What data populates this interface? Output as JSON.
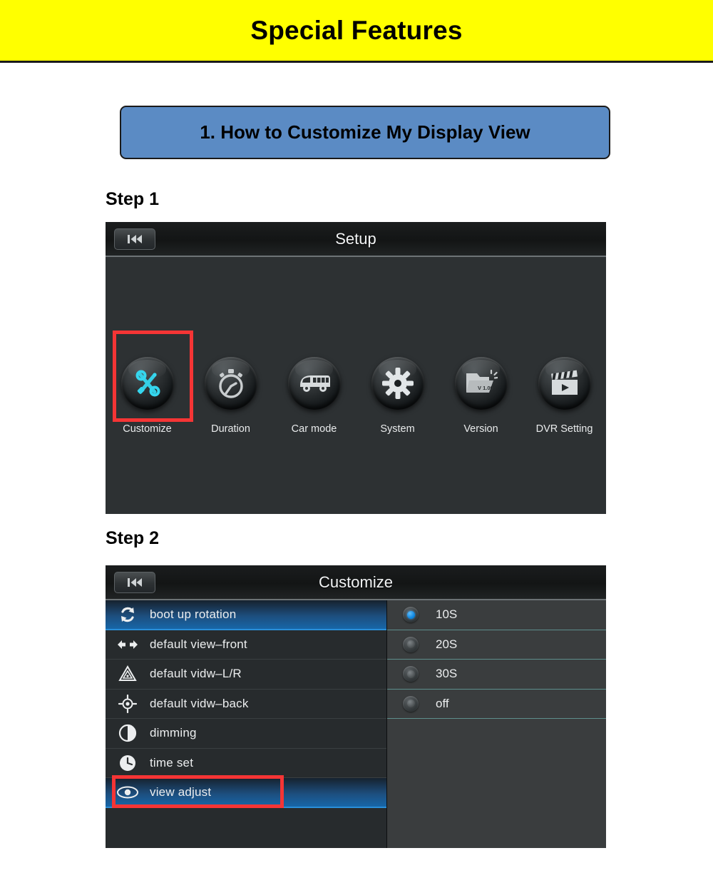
{
  "banner": {
    "title": "Special Features"
  },
  "section": {
    "label": "1. How to Customize My Display View"
  },
  "steps": {
    "step1": "Step 1",
    "step2": "Step 2"
  },
  "setup_screen": {
    "title": "Setup",
    "back_icon": "skip-to-start-icon",
    "icons": [
      {
        "label": "Customize",
        "icon": "tools-icon",
        "highlighted": true,
        "accent": "#35d7ef"
      },
      {
        "label": "Duration",
        "icon": "stopwatch-icon",
        "highlighted": false,
        "accent": "#c9cdcf"
      },
      {
        "label": "Car mode",
        "icon": "bus-icon",
        "highlighted": false,
        "accent": "#d7dbdd"
      },
      {
        "label": "System",
        "icon": "gear-icon",
        "highlighted": false,
        "accent": "#e2e6e8"
      },
      {
        "label": "Version",
        "icon": "folder-version-icon",
        "highlighted": false,
        "accent": "#c9cdcf",
        "badge": "V 1.00"
      },
      {
        "label": "DVR Setting",
        "icon": "clapperboard-icon",
        "highlighted": false,
        "accent": "#d7dbdd"
      }
    ]
  },
  "customize_screen": {
    "title": "Customize",
    "back_icon": "skip-to-start-icon",
    "menu": [
      {
        "label": "boot up rotation",
        "icon": "rotate-icon",
        "selected": true,
        "highlighted": false
      },
      {
        "label": "default view–front",
        "icon": "left-right-arrows-icon",
        "selected": false,
        "highlighted": false
      },
      {
        "label": "default vidw–L/R",
        "icon": "warning-triangle-icon",
        "selected": false,
        "highlighted": false
      },
      {
        "label": "default vidw–back",
        "icon": "crosshair-icon",
        "selected": false,
        "highlighted": false
      },
      {
        "label": "dimming",
        "icon": "contrast-icon",
        "selected": false,
        "highlighted": false
      },
      {
        "label": "time set",
        "icon": "clock-icon",
        "selected": false,
        "highlighted": false
      },
      {
        "label": "view adjust",
        "icon": "eye-icon",
        "selected": true,
        "highlighted": true
      }
    ],
    "options": [
      {
        "label": "10S",
        "checked": true
      },
      {
        "label": "20S",
        "checked": false
      },
      {
        "label": "30S",
        "checked": false
      },
      {
        "label": "off",
        "checked": false
      }
    ]
  },
  "colors": {
    "banner_bg": "#ffff00",
    "section_bg": "#5b8bc4",
    "highlight_red": "#f53535",
    "selected_blue": "#1766a8",
    "accent_cyan": "#35d7ef",
    "screen_bg": "#2d3133"
  }
}
